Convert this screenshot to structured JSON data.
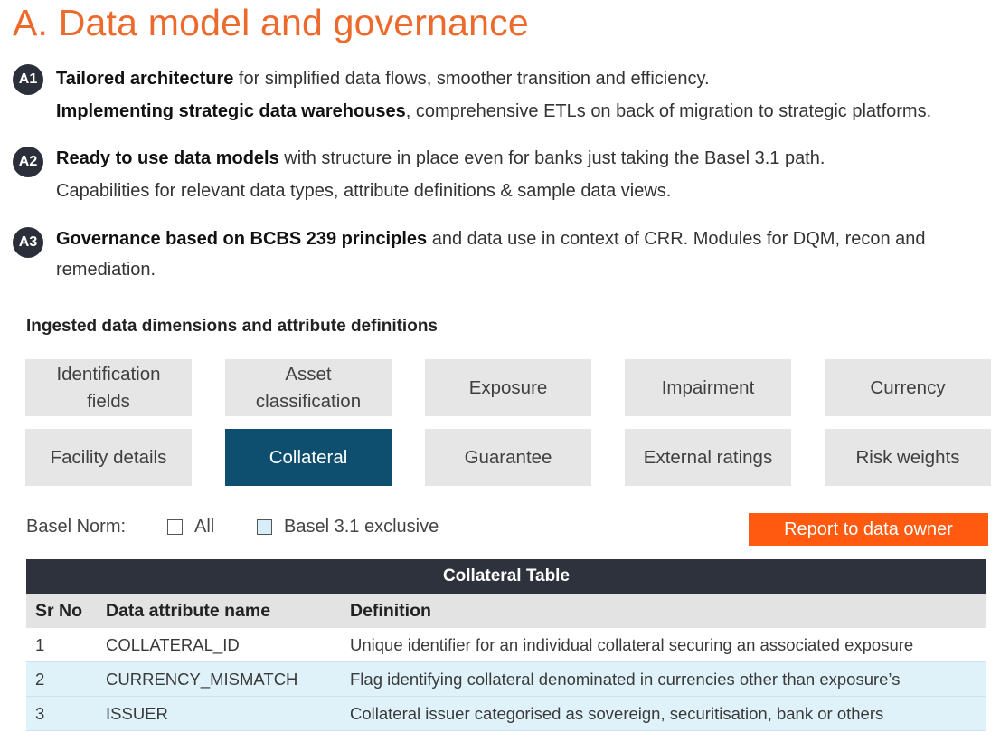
{
  "page": {
    "title": "A. Data model and governance"
  },
  "points": [
    {
      "badge": "A1",
      "line1_bold": "Tailored architecture",
      "line1_rest": " for simplified data flows, smoother transition and efficiency.",
      "line2_bold": "Implementing strategic data warehouses",
      "line2_rest": ", comprehensive ETLs on back of migration to strategic platforms."
    },
    {
      "badge": "A2",
      "line1_bold": "Ready to use data models",
      "line1_rest": " with structure in place even for banks just taking the Basel 3.1 path.",
      "line2_bold": "",
      "line2_rest": "Capabilities for relevant data types, attribute definitions & sample data views."
    },
    {
      "badge": "A3",
      "line1_bold": "Governance based on BCBS 239 principles",
      "line1_rest": " and data use in context of CRR. Modules for DQM, recon and",
      "line2_bold": "",
      "line2_rest": "remediation."
    }
  ],
  "dimensions": {
    "heading": "Ingested data dimensions and attribute definitions",
    "tiles": [
      {
        "line1": "Identification",
        "line2": "fields"
      },
      {
        "line1": "Asset",
        "line2": "classification"
      },
      {
        "line1": "Exposure",
        "line2": ""
      },
      {
        "line1": "Impairment",
        "line2": ""
      },
      {
        "line1": "Currency",
        "line2": ""
      },
      {
        "line1": "Facility details",
        "line2": ""
      },
      {
        "line1": "Collateral",
        "line2": ""
      },
      {
        "line1": "Guarantee",
        "line2": ""
      },
      {
        "line1": "External ratings",
        "line2": ""
      },
      {
        "line1": "Risk weights",
        "line2": ""
      }
    ],
    "selected": "Collateral"
  },
  "filter": {
    "label": "Basel Norm:",
    "option_all": "All",
    "option_exclusive": "Basel 3.1 exclusive"
  },
  "actions": {
    "report_label": "Report to data owner"
  },
  "table": {
    "caption": "Collateral Table",
    "headers": [
      "Sr No",
      "Data attribute name",
      "Definition"
    ],
    "rows": [
      {
        "sr": "1",
        "name": "COLLATERAL_ID",
        "definition": "Unique identifier for an individual collateral securing an associated exposure"
      },
      {
        "sr": "2",
        "name": "CURRENCY_MISMATCH",
        "definition": "Flag identifying collateral denominated in currencies other than exposure’s"
      },
      {
        "sr": "3",
        "name": "ISSUER",
        "definition": "Collateral issuer categorised as sovereign, securitisation, bank or others"
      }
    ]
  },
  "colors": {
    "title": "#ec6a2c",
    "badge": "#2b2f3a",
    "tile": "#e6e6e6",
    "tile_active": "#0e4e6e",
    "report_button": "#ff5a0f",
    "table_caption": "#2e323d",
    "table_header": "#e3e3e3",
    "row_highlight": "#dff1f9"
  }
}
